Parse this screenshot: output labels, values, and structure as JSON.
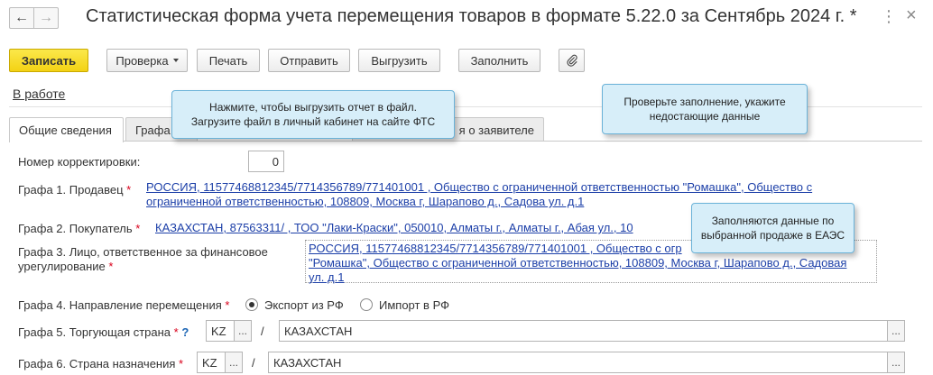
{
  "window": {
    "title": "Статистическая форма учета перемещения товаров в формате 5.22.0 за Сентябрь 2024 г. *",
    "more_icon": "more-icon",
    "close_icon": "close-icon"
  },
  "toolbar": {
    "save_label": "Записать",
    "check_label": "Проверка",
    "print_label": "Печать",
    "send_label": "Отправить",
    "export_label": "Выгрузить",
    "fill_label": "Заполнить",
    "attach_icon": "paperclip-icon"
  },
  "status": {
    "label": "В работе"
  },
  "tabs": [
    {
      "label": "Общие сведения",
      "active": true
    },
    {
      "label": "Графа",
      "active": false
    },
    {
      "label": "я о заявителе",
      "active": false
    }
  ],
  "form": {
    "correction": {
      "label": "Номер корректировки:",
      "value": "0"
    },
    "seller": {
      "label": "Графа 1. Продавец",
      "line1": "РОССИЯ, 11577468812345/7714356789/771401001 , Общество с ограниченной ответственностью \"Ромашка\", Общество с",
      "line2": "ограниченной ответственностью, 108809, Москва г, Шарапово д., Садова ул. д.1"
    },
    "buyer": {
      "label": "Графа 2. Покупатель",
      "value": "КАЗАХСТАН, 87563311/ , ТОО \"Лаки-Краски\", 050010, Алматы  г., Алматы  г., Абая ул., 10"
    },
    "responsible": {
      "label_line1": "Графа 3. Лицо, ответственное за финансовое",
      "label_line2": "урегулирование",
      "line1": "РОССИЯ, 11577468812345/7714356789/771401001 , Общество с огр",
      "line2": "\"Ромашка\", Общество с ограниченной ответственностью, 108809, Москва г, Шарапово д., Садовая",
      "line3": "ул. д.1"
    },
    "direction": {
      "label": "Графа 4. Направление перемещения",
      "option_export": "Экспорт из РФ",
      "option_import": "Импорт в РФ",
      "selected": "Экспорт из РФ"
    },
    "trade_country": {
      "label": "Графа 5. Торгующая страна",
      "help": "?",
      "code": "KZ",
      "dots": "...",
      "separator": "/",
      "name": "КАЗАХСТАН"
    },
    "dest_country": {
      "label": "Графа 6. Страна назначения",
      "code": "KZ",
      "dots": "...",
      "separator": "/",
      "name": "КАЗАХСТАН"
    },
    "required_mark": "*"
  },
  "callouts": {
    "export": {
      "line1": "Нажмите, чтобы выгрузить отчет в файл.",
      "line2": "Загрузите файл в личный кабинет на сайте ФТС"
    },
    "check": {
      "line1": "Проверьте заполнение, укажите",
      "line2": "недостающие данные"
    },
    "buyer": {
      "line1": "Заполняются данные по",
      "line2": "выбранной продаже в ЕАЭС"
    }
  }
}
